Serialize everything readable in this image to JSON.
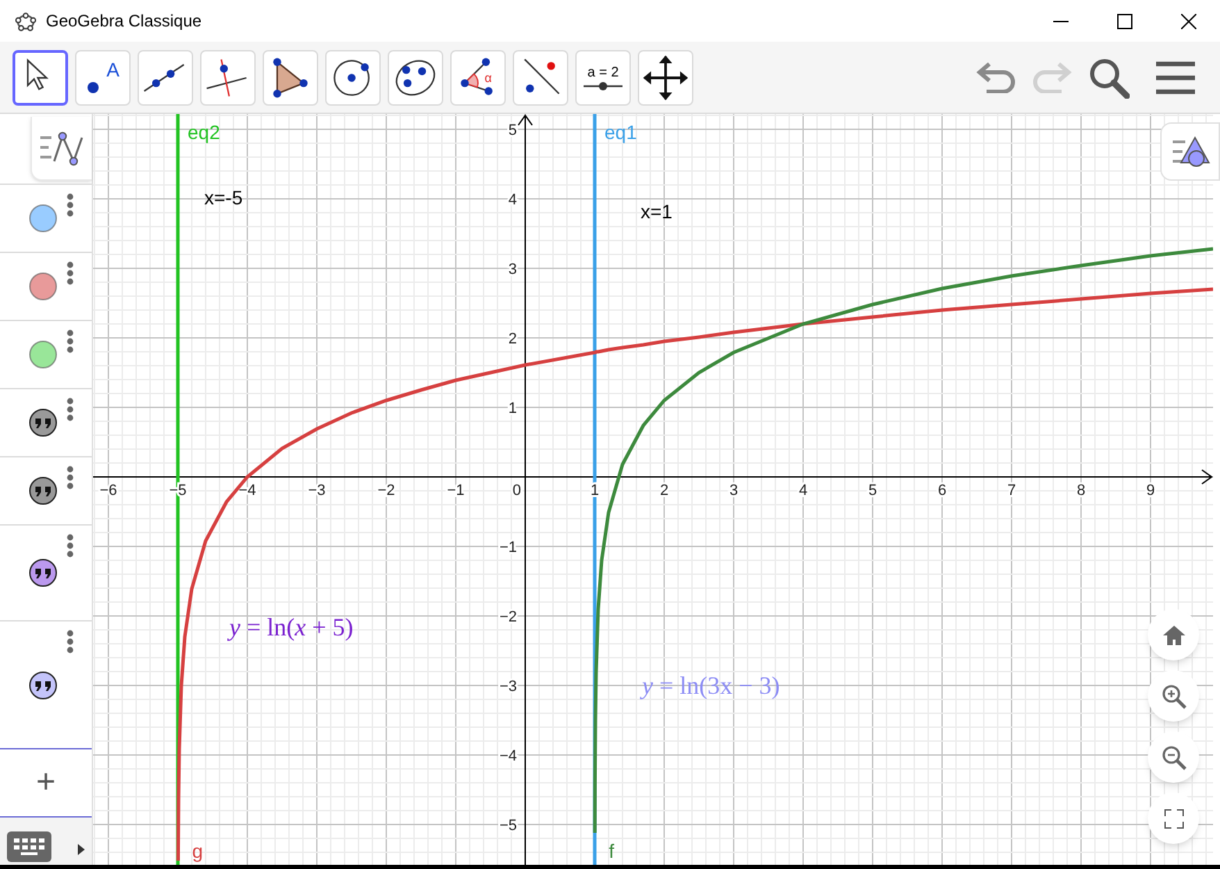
{
  "window": {
    "title": "GeoGebra Classique"
  },
  "toolbar": {
    "tools": [
      {
        "kind": "move",
        "selected": true
      },
      {
        "kind": "point",
        "selected": false,
        "label": "A"
      },
      {
        "kind": "line",
        "selected": false
      },
      {
        "kind": "perpendicular",
        "selected": false
      },
      {
        "kind": "polygon",
        "selected": false
      },
      {
        "kind": "circle",
        "selected": false
      },
      {
        "kind": "conic",
        "selected": false
      },
      {
        "kind": "angle",
        "selected": false,
        "label": "α"
      },
      {
        "kind": "reflect",
        "selected": false
      },
      {
        "kind": "slider",
        "selected": false,
        "label": "a = 2"
      },
      {
        "kind": "move_view",
        "selected": false
      }
    ],
    "undo": {
      "disabled": false
    },
    "redo": {
      "disabled": true
    }
  },
  "algebra": {
    "items": [
      {
        "kind": "object",
        "color": "#99ccff"
      },
      {
        "kind": "object",
        "color": "#e89a9a"
      },
      {
        "kind": "object",
        "color": "#99e699"
      },
      {
        "kind": "text",
        "color": "#999999"
      },
      {
        "kind": "text",
        "color": "#999999"
      },
      {
        "kind": "text",
        "color": "#bb99ee"
      },
      {
        "kind": "text",
        "color": "#c4c4fa"
      }
    ],
    "add": "+"
  },
  "graphics": {
    "texts": [
      {
        "kind": "plain",
        "text": "x=-5"
      },
      {
        "kind": "plain",
        "text": "x=1"
      },
      {
        "kind": "formula",
        "text": "*y* = ln(*x* + 5)",
        "color": "#7b22d0"
      },
      {
        "kind": "formula",
        "text": "*y* = ln(3x − 3)",
        "color": "#8c8cf5"
      }
    ],
    "chart_data": {
      "type": "line",
      "grid": true,
      "xlim": [
        -6.22,
        9.9
      ],
      "ylim": [
        -5.58,
        5.22
      ],
      "x": [
        -4.996,
        -4.99,
        -4.98,
        -4.95,
        -4.9,
        -4.8,
        -4.6,
        -4.3,
        -4,
        -3.5,
        -3,
        -2.5,
        -2,
        -1.5,
        -1,
        0,
        1,
        1.002,
        1.004,
        1.01,
        1.02,
        1.05,
        1.1,
        1.2,
        1.4,
        1.7,
        2,
        2.5,
        3,
        4,
        5,
        6,
        7,
        8,
        9,
        9.9
      ],
      "series": [
        {
          "name": "g",
          "color": "#d64040",
          "values": [
            -5.52,
            -4.61,
            -3.91,
            -3,
            -2.3,
            -1.61,
            -0.92,
            -0.36,
            0,
            0.41,
            0.69,
            0.92,
            1.1,
            1.25,
            1.39,
            1.61,
            1.79,
            1.79,
            1.79,
            1.79,
            1.8,
            1.8,
            1.81,
            1.83,
            1.86,
            1.9,
            1.95,
            2.01,
            2.08,
            2.2,
            2.3,
            2.4,
            2.48,
            2.56,
            2.64,
            2.7
          ]
        },
        {
          "name": "f",
          "color": "#3d8a3d",
          "values": [
            null,
            null,
            null,
            null,
            null,
            null,
            null,
            null,
            null,
            null,
            null,
            null,
            null,
            null,
            null,
            null,
            null,
            -5.12,
            -4.42,
            -3.51,
            -2.81,
            -1.9,
            -1.2,
            -0.51,
            0.18,
            0.74,
            1.1,
            1.5,
            1.79,
            2.2,
            2.48,
            2.71,
            2.89,
            3.04,
            3.18,
            3.28
          ]
        }
      ],
      "xticks": [
        {
          "value": -6,
          "label": "−6"
        },
        {
          "value": -5,
          "label": "−5"
        },
        {
          "value": -4,
          "label": "−4"
        },
        {
          "value": -3,
          "label": "−3"
        },
        {
          "value": -2,
          "label": "−2"
        },
        {
          "value": -1,
          "label": "−1"
        },
        0,
        1,
        2,
        3,
        4,
        5,
        6,
        7,
        8,
        9
      ],
      "yticks": [
        {
          "value": -5,
          "label": "−5"
        },
        {
          "value": -4,
          "label": "−4"
        },
        {
          "value": -3,
          "label": "−3"
        },
        {
          "value": -2,
          "label": "−2"
        },
        {
          "value": -1,
          "label": "−1"
        },
        1,
        2,
        3,
        4,
        5
      ],
      "ref_lines": [
        {
          "axis": "x",
          "value": -5,
          "label": "eq2",
          "color": "#22c322"
        },
        {
          "axis": "x",
          "value": 1,
          "label": "eq1",
          "color": "#3aa0e8"
        }
      ]
    }
  }
}
